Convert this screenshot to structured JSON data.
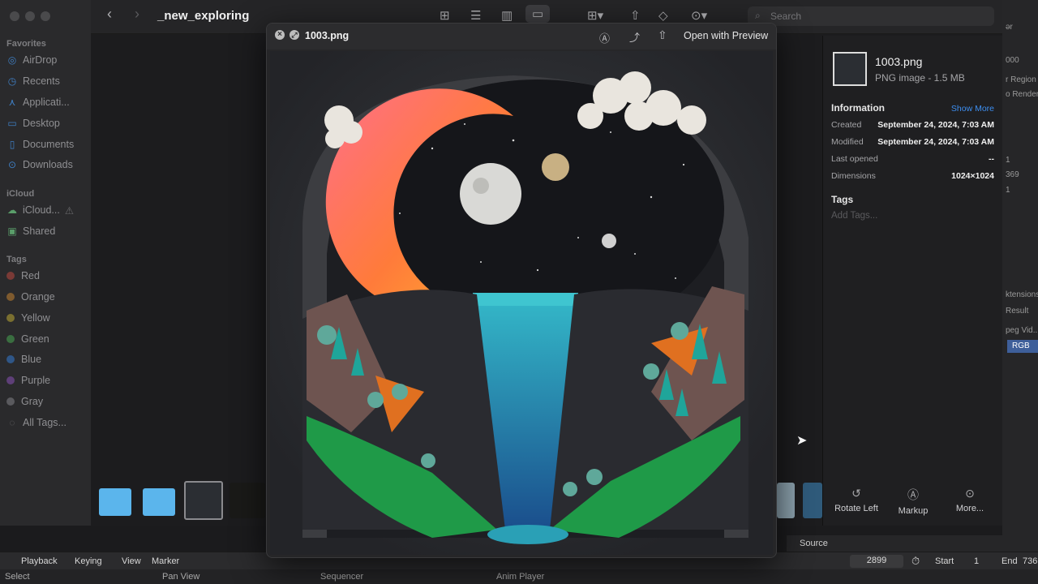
{
  "finder": {
    "folder_title": "_new_exploring",
    "search_placeholder": "Search",
    "sidebar": {
      "favorites_heading": "Favorites",
      "favorites": [
        {
          "label": "AirDrop",
          "icon": "airdrop-icon"
        },
        {
          "label": "Recents",
          "icon": "clock-icon"
        },
        {
          "label": "Applicati...",
          "icon": "applications-icon"
        },
        {
          "label": "Desktop",
          "icon": "desktop-icon"
        },
        {
          "label": "Documents",
          "icon": "document-icon"
        },
        {
          "label": "Downloads",
          "icon": "download-icon"
        }
      ],
      "icloud_heading": "iCloud",
      "icloud": [
        {
          "label": "iCloud...",
          "icon": "cloud-icon"
        },
        {
          "label": "Shared",
          "icon": "shared-folder-icon"
        }
      ],
      "tags_heading": "Tags",
      "tags": [
        {
          "label": "Red",
          "color": "#e0544b"
        },
        {
          "label": "Orange",
          "color": "#e5973a"
        },
        {
          "label": "Yellow",
          "color": "#d9c53c"
        },
        {
          "label": "Green",
          "color": "#4fb35a"
        },
        {
          "label": "Blue",
          "color": "#3d7fd9"
        },
        {
          "label": "Purple",
          "color": "#a05fc9"
        },
        {
          "label": "Gray",
          "color": "#8e8e93"
        }
      ],
      "all_tags": "All Tags..."
    }
  },
  "quicklook": {
    "title": "1003.png",
    "open_with": "Open with Preview"
  },
  "info": {
    "filename": "1003.png",
    "subtitle": "PNG image - 1.5 MB",
    "section_title": "Information",
    "show_more": "Show More",
    "rows": [
      {
        "label": "Created",
        "value": "September 24, 2024, 7:03 AM"
      },
      {
        "label": "Modified",
        "value": "September 24, 2024, 7:03 AM"
      },
      {
        "label": "Last opened",
        "value": "--"
      },
      {
        "label": "Dimensions",
        "value": "1024×1024"
      }
    ],
    "tags_title": "Tags",
    "tags_placeholder": "Add Tags...",
    "actions": [
      {
        "label": "Rotate Left",
        "icon": "rotate-left-icon"
      },
      {
        "label": "Markup",
        "icon": "markup-icon"
      },
      {
        "label": "More...",
        "icon": "more-icon"
      }
    ]
  },
  "blender": {
    "right_partial": {
      "r0": "ər",
      "r1": "000",
      "r2": "r Region",
      "r3": "o Render",
      "r4": "1",
      "r5": "369",
      "r6": "1",
      "r7": "ktensions",
      "r8": "Result",
      "r9": "peg Vid...",
      "r10": "RGB"
    },
    "source_label": "Source",
    "menu": [
      "Playback",
      "Keying",
      "View",
      "Marker"
    ],
    "current_frame": "2899",
    "start_label": "Start",
    "start_value": "1",
    "end_label": "End",
    "end_value": "736",
    "status": {
      "select": "Select",
      "pan_view": "Pan View",
      "sequencer": "Sequencer",
      "anim_player": "Anim Player"
    }
  }
}
